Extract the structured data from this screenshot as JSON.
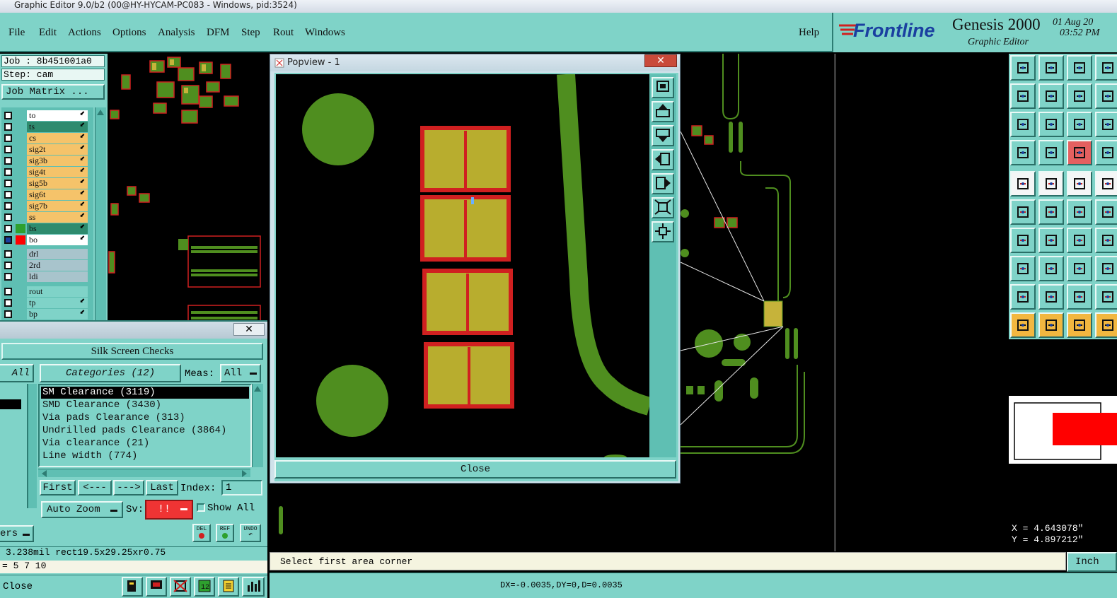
{
  "window": {
    "title": "Graphic Editor 9.0/b2 (00@HY-HYCAM-PC083 - Windows, pid:3524)"
  },
  "menu": {
    "items": [
      "File",
      "Edit",
      "Actions",
      "Options",
      "Analysis",
      "DFM",
      "Step",
      "Rout",
      "Windows"
    ],
    "help": "Help"
  },
  "brand": {
    "logo": "Frontline",
    "product": "Genesis 2000",
    "subtitle": "Graphic Editor",
    "date": "01 Aug 20",
    "time": "03:52 PM"
  },
  "job": {
    "job": "Job : 8b451001a0",
    "step": "Step: cam",
    "matrix_button": "Job Matrix ..."
  },
  "layers": [
    {
      "name": "to",
      "color": "#ffffff"
    },
    {
      "name": "ts",
      "color": "#2e8b6e"
    },
    {
      "name": "cs",
      "color": "#f5c36a"
    },
    {
      "name": "sig2t",
      "color": "#f5c36a"
    },
    {
      "name": "sig3b",
      "color": "#f5c36a"
    },
    {
      "name": "sig4t",
      "color": "#f5c36a"
    },
    {
      "name": "sig5b",
      "color": "#f5c36a"
    },
    {
      "name": "sig6t",
      "color": "#f5c36a"
    },
    {
      "name": "sig7b",
      "color": "#f5c36a"
    },
    {
      "name": "ss",
      "color": "#f5c36a"
    },
    {
      "name": "bs",
      "color": "#2e8b6e"
    },
    {
      "name": "bo",
      "color": "#ffffff"
    },
    {
      "name": "drl",
      "color": "#a8c4cc"
    },
    {
      "name": "2rd",
      "color": "#a8c4cc"
    },
    {
      "name": "ldi",
      "color": "#a8c4cc"
    },
    {
      "name": "rout",
      "color": "#7fd3c8"
    },
    {
      "name": "tp",
      "color": "#7fd3c8"
    },
    {
      "name": "bp",
      "color": "#7fd3c8"
    }
  ],
  "silk": {
    "title": "Silk Screen Checks",
    "all_button": "All",
    "categories": "Categories (12)",
    "meas_label": "Meas:",
    "meas_value": "All",
    "results": [
      "SM Clearance (3119)",
      "SMD Clearance (3430)",
      "Via pads Clearance (313)",
      "Undrilled pads Clearance (3864)",
      "Via clearance (21)",
      "Line width (774)"
    ],
    "nav": {
      "first": "First",
      "prev": "<---",
      "next": "--->",
      "last": "Last",
      "index_label": "Index:",
      "index_value": "1"
    },
    "auto_zoom": "Auto Zoom",
    "sv_label": "Sv:",
    "sv_value": "!!",
    "show_all": "Show All",
    "filter_label": "ers",
    "icons": [
      "DEL",
      "REF",
      "UNDO"
    ],
    "info_line": "3.238mil  rect19.5x29.25xr0.75",
    "params_line": "= 5 7 10",
    "close_label": "Close"
  },
  "popview": {
    "title": "Popview - 1",
    "close_button": "Close"
  },
  "status": {
    "prompt": "Select first area corner",
    "units": "Inch",
    "delta": "DX=-0.0035,DY=0,D=0.0035"
  },
  "coords": {
    "x": "X = 4.643078\"",
    "y": "Y = 4.897212\""
  }
}
